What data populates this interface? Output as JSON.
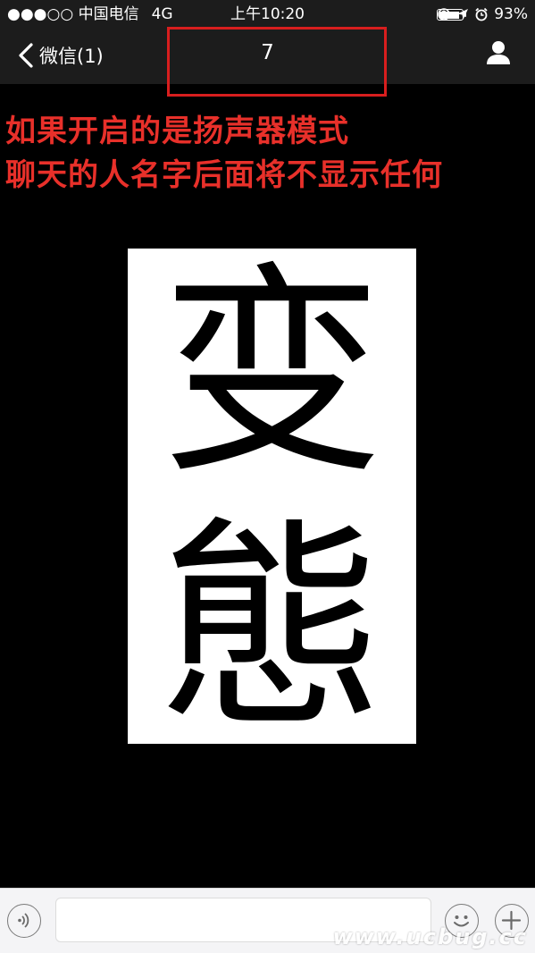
{
  "status_bar": {
    "carrier": "●●●○○ 中国电信",
    "network": "4G",
    "time": "上午10:20",
    "battery_percent": "93%",
    "battery_level": 0.93
  },
  "nav": {
    "back_label": "微信(1)",
    "title": "7",
    "highlight_color": "#d81e1e"
  },
  "annotation": {
    "line1": "如果开启的是扬声器模式",
    "line2": "聊天的人名字后面将不显示任何",
    "color": "#e8302a"
  },
  "message_image": {
    "char1": "变",
    "char2": "態"
  },
  "input_bar": {
    "placeholder": "",
    "icons": [
      "voice-icon",
      "emoji-icon",
      "plus-icon"
    ]
  },
  "watermark": "www.ucbug.cc"
}
